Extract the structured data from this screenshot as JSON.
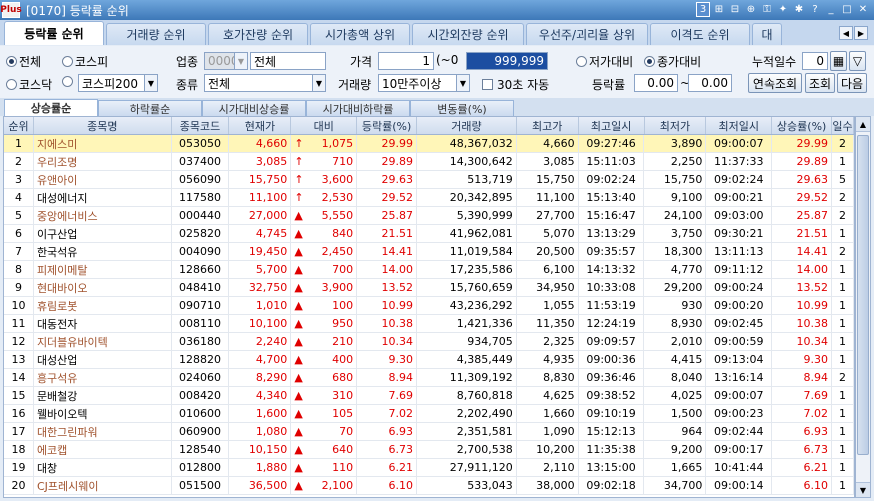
{
  "window": {
    "logo": "Plus",
    "title": "[0170] 등락률 순위",
    "screen_number": "3"
  },
  "tabs": [
    "등락률 순위",
    "거래량 순위",
    "호가잔량 순위",
    "시가총액 상위",
    "시간외잔량 순위",
    "우선주/괴리율 상위",
    "이격도 순위",
    "대"
  ],
  "filters": {
    "market_all": "전체",
    "kospi": "코스피",
    "kosdaq": "코스닥",
    "index_select": "코스피200",
    "sector_label": "업종",
    "sector_code": "0000",
    "sector_name": "전체",
    "type_label": "종류",
    "type_value": "전체",
    "price_label": "가격",
    "price_from": "1",
    "price_sep": "(~0",
    "price_to": "999,999",
    "volume_label": "거래량",
    "volume_value": "10만주이상",
    "auto_label": "30초 자동",
    "prev_low": "저가대비",
    "prev_close": "종가대비",
    "rate_label": "등락률",
    "rate_from": "0.00",
    "rate_sep": "~",
    "rate_to": "0.00",
    "cum_days_label": "누적일수",
    "cum_days_value": "0",
    "btn_continuous": "연속조회",
    "btn_query": "조회",
    "btn_next": "다음"
  },
  "subtabs": [
    "상승률순",
    "하락률순",
    "시가대비상승률",
    "시가대비하락률",
    "변동률(%)"
  ],
  "columns": [
    "순위",
    "종목명",
    "종목코드",
    "현재가",
    "대비",
    "등락률(%)",
    "거래량",
    "최고가",
    "최고일시",
    "최저가",
    "최저일시",
    "상승률(%)",
    "일수"
  ],
  "rows": [
    {
      "rank": "1",
      "name": "지에스미",
      "code": "053050",
      "price": "4,660",
      "sign": "↑",
      "diff": "1,075",
      "rate": "29.99",
      "volume": "48,367,032",
      "high": "4,660",
      "high_time": "09:27:46",
      "low": "3,890",
      "low_time": "09:00:07",
      "up_rate": "29.99",
      "days": "2",
      "style": "brown"
    },
    {
      "rank": "2",
      "name": "우리조명",
      "code": "037400",
      "price": "3,085",
      "sign": "↑",
      "diff": "710",
      "rate": "29.89",
      "volume": "14,300,642",
      "high": "3,085",
      "high_time": "15:11:03",
      "low": "2,250",
      "low_time": "11:37:33",
      "up_rate": "29.89",
      "days": "1",
      "style": "brown"
    },
    {
      "rank": "3",
      "name": "유앤아이",
      "code": "056090",
      "price": "15,750",
      "sign": "↑",
      "diff": "3,600",
      "rate": "29.63",
      "volume": "513,719",
      "high": "15,750",
      "high_time": "09:02:24",
      "low": "15,750",
      "low_time": "09:02:24",
      "up_rate": "29.63",
      "days": "5",
      "style": "brown"
    },
    {
      "rank": "4",
      "name": "대성에너지",
      "code": "117580",
      "price": "11,100",
      "sign": "↑",
      "diff": "2,530",
      "rate": "29.52",
      "volume": "20,342,895",
      "high": "11,100",
      "high_time": "15:13:40",
      "low": "9,100",
      "low_time": "09:00:21",
      "up_rate": "29.52",
      "days": "2",
      "style": "dark"
    },
    {
      "rank": "5",
      "name": "중앙에너비스",
      "code": "000440",
      "price": "27,000",
      "sign": "▲",
      "diff": "5,550",
      "rate": "25.87",
      "volume": "5,390,999",
      "high": "27,700",
      "high_time": "15:16:47",
      "low": "24,100",
      "low_time": "09:03:00",
      "up_rate": "25.87",
      "days": "2",
      "style": "brown"
    },
    {
      "rank": "6",
      "name": "이구산업",
      "code": "025820",
      "price": "4,745",
      "sign": "▲",
      "diff": "840",
      "rate": "21.51",
      "volume": "41,962,081",
      "high": "5,070",
      "high_time": "13:13:29",
      "low": "3,750",
      "low_time": "09:30:21",
      "up_rate": "21.51",
      "days": "1",
      "style": "dark"
    },
    {
      "rank": "7",
      "name": "한국석유",
      "code": "004090",
      "price": "19,450",
      "sign": "▲",
      "diff": "2,450",
      "rate": "14.41",
      "volume": "11,019,584",
      "high": "20,500",
      "high_time": "09:35:57",
      "low": "18,300",
      "low_time": "13:11:13",
      "up_rate": "14.41",
      "days": "2",
      "style": "dark"
    },
    {
      "rank": "8",
      "name": "피제이메탈",
      "code": "128660",
      "price": "5,700",
      "sign": "▲",
      "diff": "700",
      "rate": "14.00",
      "volume": "17,235,586",
      "high": "6,100",
      "high_time": "14:13:32",
      "low": "4,770",
      "low_time": "09:11:12",
      "up_rate": "14.00",
      "days": "1",
      "style": "brown"
    },
    {
      "rank": "9",
      "name": "현대바이오",
      "code": "048410",
      "price": "32,750",
      "sign": "▲",
      "diff": "3,900",
      "rate": "13.52",
      "volume": "15,760,659",
      "high": "34,950",
      "high_time": "10:33:08",
      "low": "29,200",
      "low_time": "09:00:24",
      "up_rate": "13.52",
      "days": "1",
      "style": "brown"
    },
    {
      "rank": "10",
      "name": "휴림로봇",
      "code": "090710",
      "price": "1,010",
      "sign": "▲",
      "diff": "100",
      "rate": "10.99",
      "volume": "43,236,292",
      "high": "1,055",
      "high_time": "11:53:19",
      "low": "930",
      "low_time": "09:00:20",
      "up_rate": "10.99",
      "days": "1",
      "style": "brown"
    },
    {
      "rank": "11",
      "name": "대동전자",
      "code": "008110",
      "price": "10,100",
      "sign": "▲",
      "diff": "950",
      "rate": "10.38",
      "volume": "1,421,336",
      "high": "11,350",
      "high_time": "12:24:19",
      "low": "8,930",
      "low_time": "09:02:45",
      "up_rate": "10.38",
      "days": "1",
      "style": "dark"
    },
    {
      "rank": "12",
      "name": "지더블유바이텍",
      "code": "036180",
      "price": "2,240",
      "sign": "▲",
      "diff": "210",
      "rate": "10.34",
      "volume": "934,705",
      "high": "2,325",
      "high_time": "09:09:57",
      "low": "2,010",
      "low_time": "09:00:59",
      "up_rate": "10.34",
      "days": "1",
      "style": "brown"
    },
    {
      "rank": "13",
      "name": "대성산업",
      "code": "128820",
      "price": "4,700",
      "sign": "▲",
      "diff": "400",
      "rate": "9.30",
      "volume": "4,385,449",
      "high": "4,935",
      "high_time": "09:00:36",
      "low": "4,415",
      "low_time": "09:13:04",
      "up_rate": "9.30",
      "days": "1",
      "style": "dark"
    },
    {
      "rank": "14",
      "name": "흥구석유",
      "code": "024060",
      "price": "8,290",
      "sign": "▲",
      "diff": "680",
      "rate": "8.94",
      "volume": "11,309,192",
      "high": "8,830",
      "high_time": "09:36:46",
      "low": "8,040",
      "low_time": "13:16:14",
      "up_rate": "8.94",
      "days": "2",
      "style": "brown"
    },
    {
      "rank": "15",
      "name": "문배철강",
      "code": "008420",
      "price": "4,340",
      "sign": "▲",
      "diff": "310",
      "rate": "7.69",
      "volume": "8,760,818",
      "high": "4,625",
      "high_time": "09:38:52",
      "low": "4,025",
      "low_time": "09:00:07",
      "up_rate": "7.69",
      "days": "1",
      "style": "dark"
    },
    {
      "rank": "16",
      "name": "웰바이오텍",
      "code": "010600",
      "price": "1,600",
      "sign": "▲",
      "diff": "105",
      "rate": "7.02",
      "volume": "2,202,490",
      "high": "1,660",
      "high_time": "09:10:19",
      "low": "1,500",
      "low_time": "09:00:23",
      "up_rate": "7.02",
      "days": "1",
      "style": "dark"
    },
    {
      "rank": "17",
      "name": "대한그린파워",
      "code": "060900",
      "price": "1,080",
      "sign": "▲",
      "diff": "70",
      "rate": "6.93",
      "volume": "2,351,581",
      "high": "1,090",
      "high_time": "15:12:13",
      "low": "964",
      "low_time": "09:02:44",
      "up_rate": "6.93",
      "days": "1",
      "style": "brown"
    },
    {
      "rank": "18",
      "name": "에코캡",
      "code": "128540",
      "price": "10,150",
      "sign": "▲",
      "diff": "640",
      "rate": "6.73",
      "volume": "2,700,538",
      "high": "10,200",
      "high_time": "11:35:38",
      "low": "9,200",
      "low_time": "09:00:17",
      "up_rate": "6.73",
      "days": "1",
      "style": "brown"
    },
    {
      "rank": "19",
      "name": "대창",
      "code": "012800",
      "price": "1,880",
      "sign": "▲",
      "diff": "110",
      "rate": "6.21",
      "volume": "27,911,120",
      "high": "2,110",
      "high_time": "13:15:00",
      "low": "1,665",
      "low_time": "10:41:44",
      "up_rate": "6.21",
      "days": "1",
      "style": "dark"
    },
    {
      "rank": "20",
      "name": "CJ프레시웨이",
      "code": "051500",
      "price": "36,500",
      "sign": "▲",
      "diff": "2,100",
      "rate": "6.10",
      "volume": "533,043",
      "high": "38,000",
      "high_time": "09:02:18",
      "low": "34,700",
      "low_time": "09:00:14",
      "up_rate": "6.10",
      "days": "1",
      "style": "brown"
    }
  ],
  "colors": {
    "up": "#e00000",
    "selected_row": "#fff6b8",
    "header": "#cfdcee",
    "title_bar": "#3d78b8"
  }
}
